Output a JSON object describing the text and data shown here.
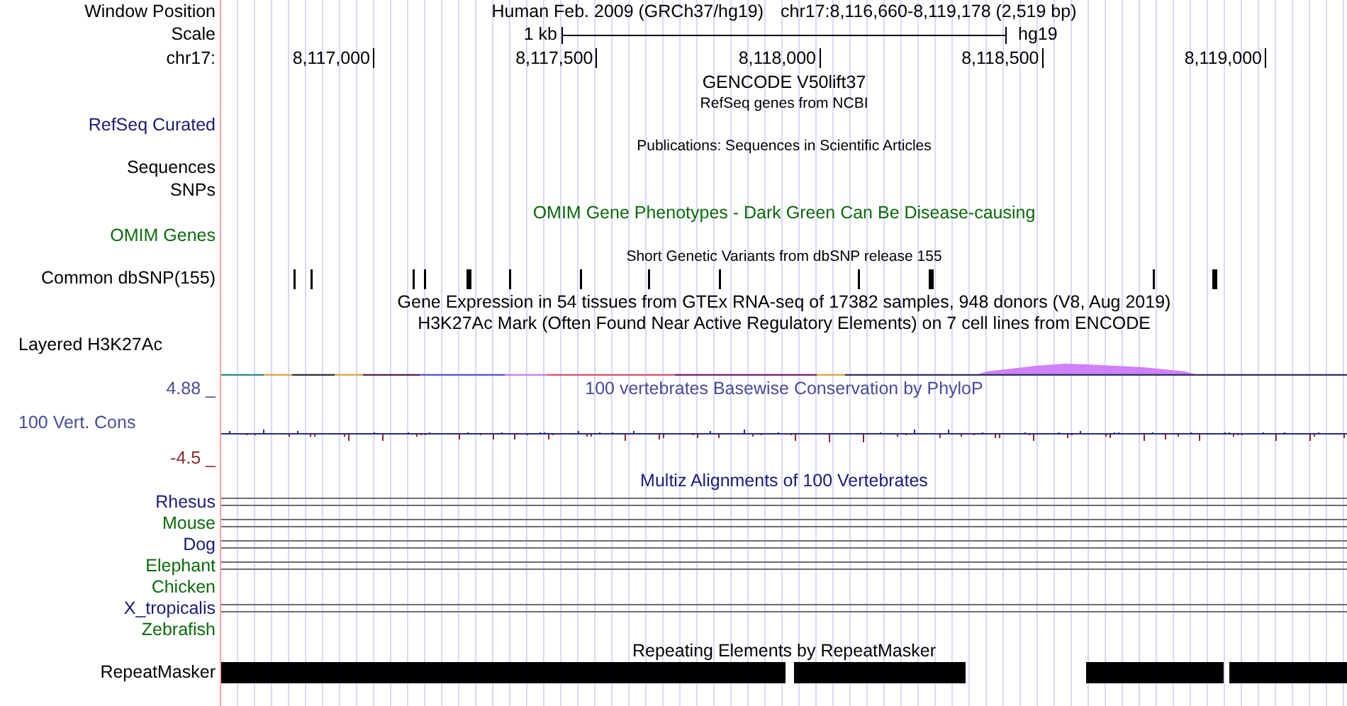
{
  "header": {
    "label": "Window Position",
    "assembly": "Human Feb. 2009 (GRCh37/hg19)",
    "position": "chr17:8,116,660-8,119,178 (2,519 bp)"
  },
  "scale": {
    "label": "Scale",
    "length": "1 kb",
    "assembly": "hg19"
  },
  "ruler": {
    "label": "chr17:",
    "ticks": [
      "8,117,000",
      "8,117,500",
      "8,118,000",
      "8,118,500",
      "8,119,000"
    ]
  },
  "gencode": {
    "title": "GENCODE V50lift37"
  },
  "refseq": {
    "title": "RefSeq genes from NCBI",
    "label": "RefSeq Curated"
  },
  "publications": {
    "title": "Publications: Sequences in Scientific Articles",
    "labels": [
      "Sequences",
      "SNPs"
    ]
  },
  "omim": {
    "title": "OMIM Gene Phenotypes - Dark Green Can Be Disease-causing",
    "label": "OMIM Genes"
  },
  "dbsnp": {
    "title": "Short Genetic Variants from dbSNP release 155",
    "label": "Common dbSNP(155)"
  },
  "gtex": {
    "title": "Gene Expression in 54 tissues from GTEx RNA-seq of 17382 samples, 948 donors (V8, Aug 2019)"
  },
  "h3k27ac": {
    "title": "H3K27Ac Mark (Often Found Near Active Regulatory Elements) on 7 cell lines from ENCODE",
    "label": "Layered H3K27Ac"
  },
  "conservation": {
    "title": "100 vertebrates Basewise Conservation by PhyloP",
    "label": "100 Vert. Cons",
    "max": "4.88 _",
    "min": "-4.5 _"
  },
  "multiz": {
    "title": "Multiz Alignments of 100 Vertebrates",
    "species": [
      {
        "name": "Rhesus",
        "color": "#1a1a78",
        "aligned": true
      },
      {
        "name": "Mouse",
        "color": "#0a6a0a",
        "aligned": true
      },
      {
        "name": "Dog",
        "color": "#1a1a78",
        "aligned": true
      },
      {
        "name": "Elephant",
        "color": "#0a6a0a",
        "aligned": true
      },
      {
        "name": "Chicken",
        "color": "#0a6a0a",
        "aligned": false
      },
      {
        "name": "X_tropicalis",
        "color": "#1a1a78",
        "aligned": true
      },
      {
        "name": "Zebrafish",
        "color": "#0a6a0a",
        "aligned": false
      }
    ]
  },
  "repeatmasker": {
    "title": "Repeating Elements by RepeatMasker",
    "label": "RepeatMasker"
  }
}
